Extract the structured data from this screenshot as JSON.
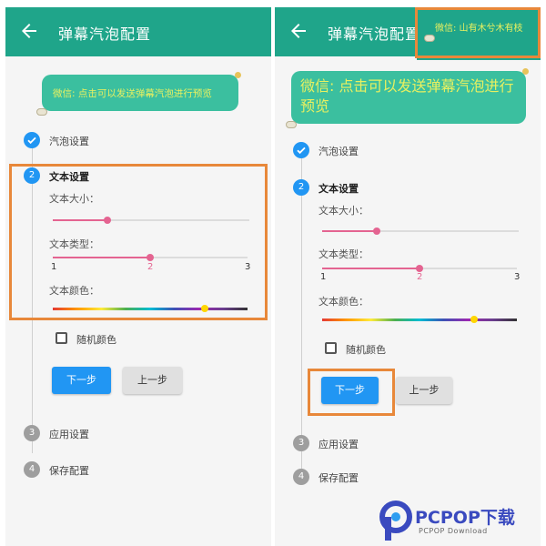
{
  "appbar": {
    "title": "弹幕汽泡配置",
    "back_icon": "arrow-back-icon",
    "color": "#1fa58a"
  },
  "bubble": {
    "text": "微信: 点击可以发送弹幕汽泡进行预览",
    "bg": "#3bbf9f",
    "text_color": "#e8f060"
  },
  "notification": {
    "text": "微信: 山有木兮木有枝"
  },
  "steps": [
    {
      "number": "1",
      "label": "汽泡设置",
      "state": "done"
    },
    {
      "number": "2",
      "label": "文本设置",
      "state": "active"
    },
    {
      "number": "3",
      "label": "应用设置",
      "state": "todo"
    },
    {
      "number": "4",
      "label": "保存配置",
      "state": "todo"
    }
  ],
  "text_settings": {
    "size_label": "文本大小：",
    "size_value": 0.28,
    "type_label": "文本类型：",
    "type_min": "1",
    "type_value": "2",
    "type_max": "3",
    "color_label": "文本颜色：",
    "color_value": 0.78,
    "random_color_label": "随机颜色",
    "random_color_checked": false
  },
  "buttons": {
    "next": "下一步",
    "prev": "上一步"
  },
  "colors": {
    "primary": "#2196f3",
    "slider": "#e46491",
    "highlight": "#e8883a"
  },
  "watermark": {
    "brand": "PCPOP下载",
    "sub": "PCPOP Download"
  }
}
